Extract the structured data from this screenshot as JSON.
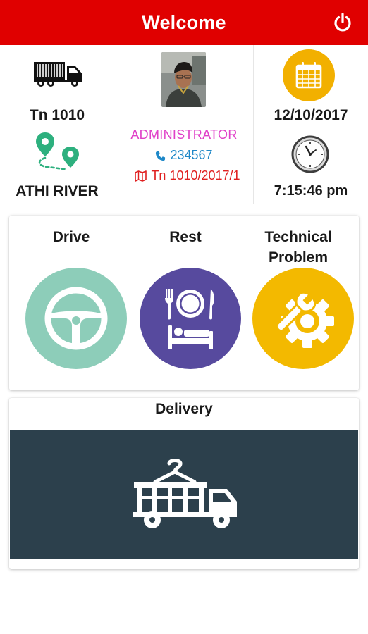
{
  "header": {
    "title": "Welcome",
    "power_icon": "power-icon"
  },
  "vehicle": {
    "number": "Tn 1010",
    "location": "ATHI RIVER"
  },
  "user": {
    "role": "ADMINISTRATOR",
    "phone": "234567",
    "trip": "Tn 1010/2017/1"
  },
  "datetime": {
    "date": "12/10/2017",
    "time": "7:15:46 pm"
  },
  "actions": [
    {
      "label": "Drive",
      "icon": "steering-wheel-icon",
      "color": "#8dcdb9"
    },
    {
      "label": "Rest",
      "icon": "rest-icon",
      "color": "#574a9e"
    },
    {
      "label": "Technical Problem",
      "icon": "wrench-gear-icon",
      "color": "#f3b900"
    }
  ],
  "delivery": {
    "label": "Delivery",
    "icon": "delivery-truck-icon",
    "color": "#2c404c"
  },
  "colors": {
    "brand": "#e00000",
    "role": "#e040c8",
    "phone": "#1e88c8",
    "trip": "#e02020"
  }
}
